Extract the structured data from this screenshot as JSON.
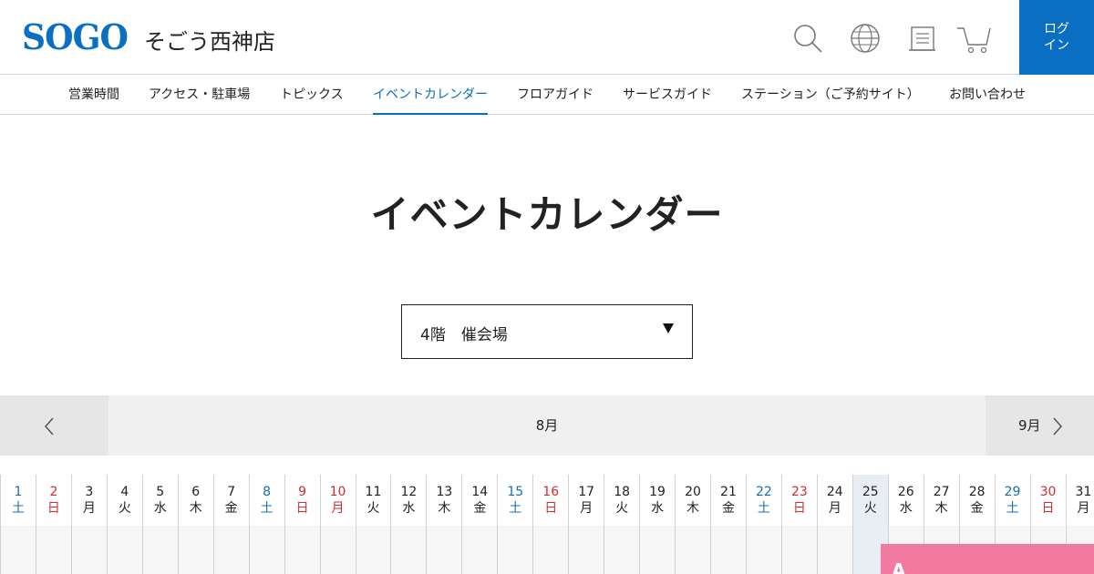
{
  "header": {
    "logo": "SOGO",
    "store_name": "そごう西神店",
    "login_line1": "ログ",
    "login_line2": "イン"
  },
  "nav": {
    "items": [
      {
        "label": "営業時間"
      },
      {
        "label": "アクセス・駐車場"
      },
      {
        "label": "トピックス"
      },
      {
        "label": "イベントカレンダー",
        "active": true
      },
      {
        "label": "フロアガイド"
      },
      {
        "label": "サービスガイド"
      },
      {
        "label": "ステーション（ご予約サイト）"
      },
      {
        "label": "お問い合わせ"
      }
    ]
  },
  "page": {
    "title": "イベントカレンダー"
  },
  "floor_select": {
    "value": "4階　催会場"
  },
  "calendar": {
    "current_month": "8月",
    "next_month": "9月",
    "days": [
      {
        "d": "1",
        "w": "土",
        "type": "sat"
      },
      {
        "d": "2",
        "w": "日",
        "type": "sun"
      },
      {
        "d": "3",
        "w": "月"
      },
      {
        "d": "4",
        "w": "火"
      },
      {
        "d": "5",
        "w": "水"
      },
      {
        "d": "6",
        "w": "木"
      },
      {
        "d": "7",
        "w": "金"
      },
      {
        "d": "8",
        "w": "土",
        "type": "sat"
      },
      {
        "d": "9",
        "w": "日",
        "type": "sun"
      },
      {
        "d": "10",
        "w": "月",
        "type": "sun"
      },
      {
        "d": "11",
        "w": "火"
      },
      {
        "d": "12",
        "w": "水"
      },
      {
        "d": "13",
        "w": "木"
      },
      {
        "d": "14",
        "w": "金"
      },
      {
        "d": "15",
        "w": "土",
        "type": "sat"
      },
      {
        "d": "16",
        "w": "日",
        "type": "sun"
      },
      {
        "d": "17",
        "w": "月"
      },
      {
        "d": "18",
        "w": "火"
      },
      {
        "d": "19",
        "w": "水"
      },
      {
        "d": "20",
        "w": "木"
      },
      {
        "d": "21",
        "w": "金"
      },
      {
        "d": "22",
        "w": "土",
        "type": "sat"
      },
      {
        "d": "23",
        "w": "日",
        "type": "sun"
      },
      {
        "d": "24",
        "w": "月"
      },
      {
        "d": "25",
        "w": "火",
        "today": true
      },
      {
        "d": "26",
        "w": "水"
      },
      {
        "d": "27",
        "w": "木"
      },
      {
        "d": "28",
        "w": "金"
      },
      {
        "d": "29",
        "w": "土",
        "type": "sat"
      },
      {
        "d": "30",
        "w": "日",
        "type": "sun"
      },
      {
        "d": "31",
        "w": "月"
      }
    ],
    "event_label": "A"
  },
  "colors": {
    "brand_blue": "#0a6fc2",
    "saturday": "#1a6fb0",
    "sunday": "#d92b2b",
    "event_pink": "#f27aa0"
  }
}
